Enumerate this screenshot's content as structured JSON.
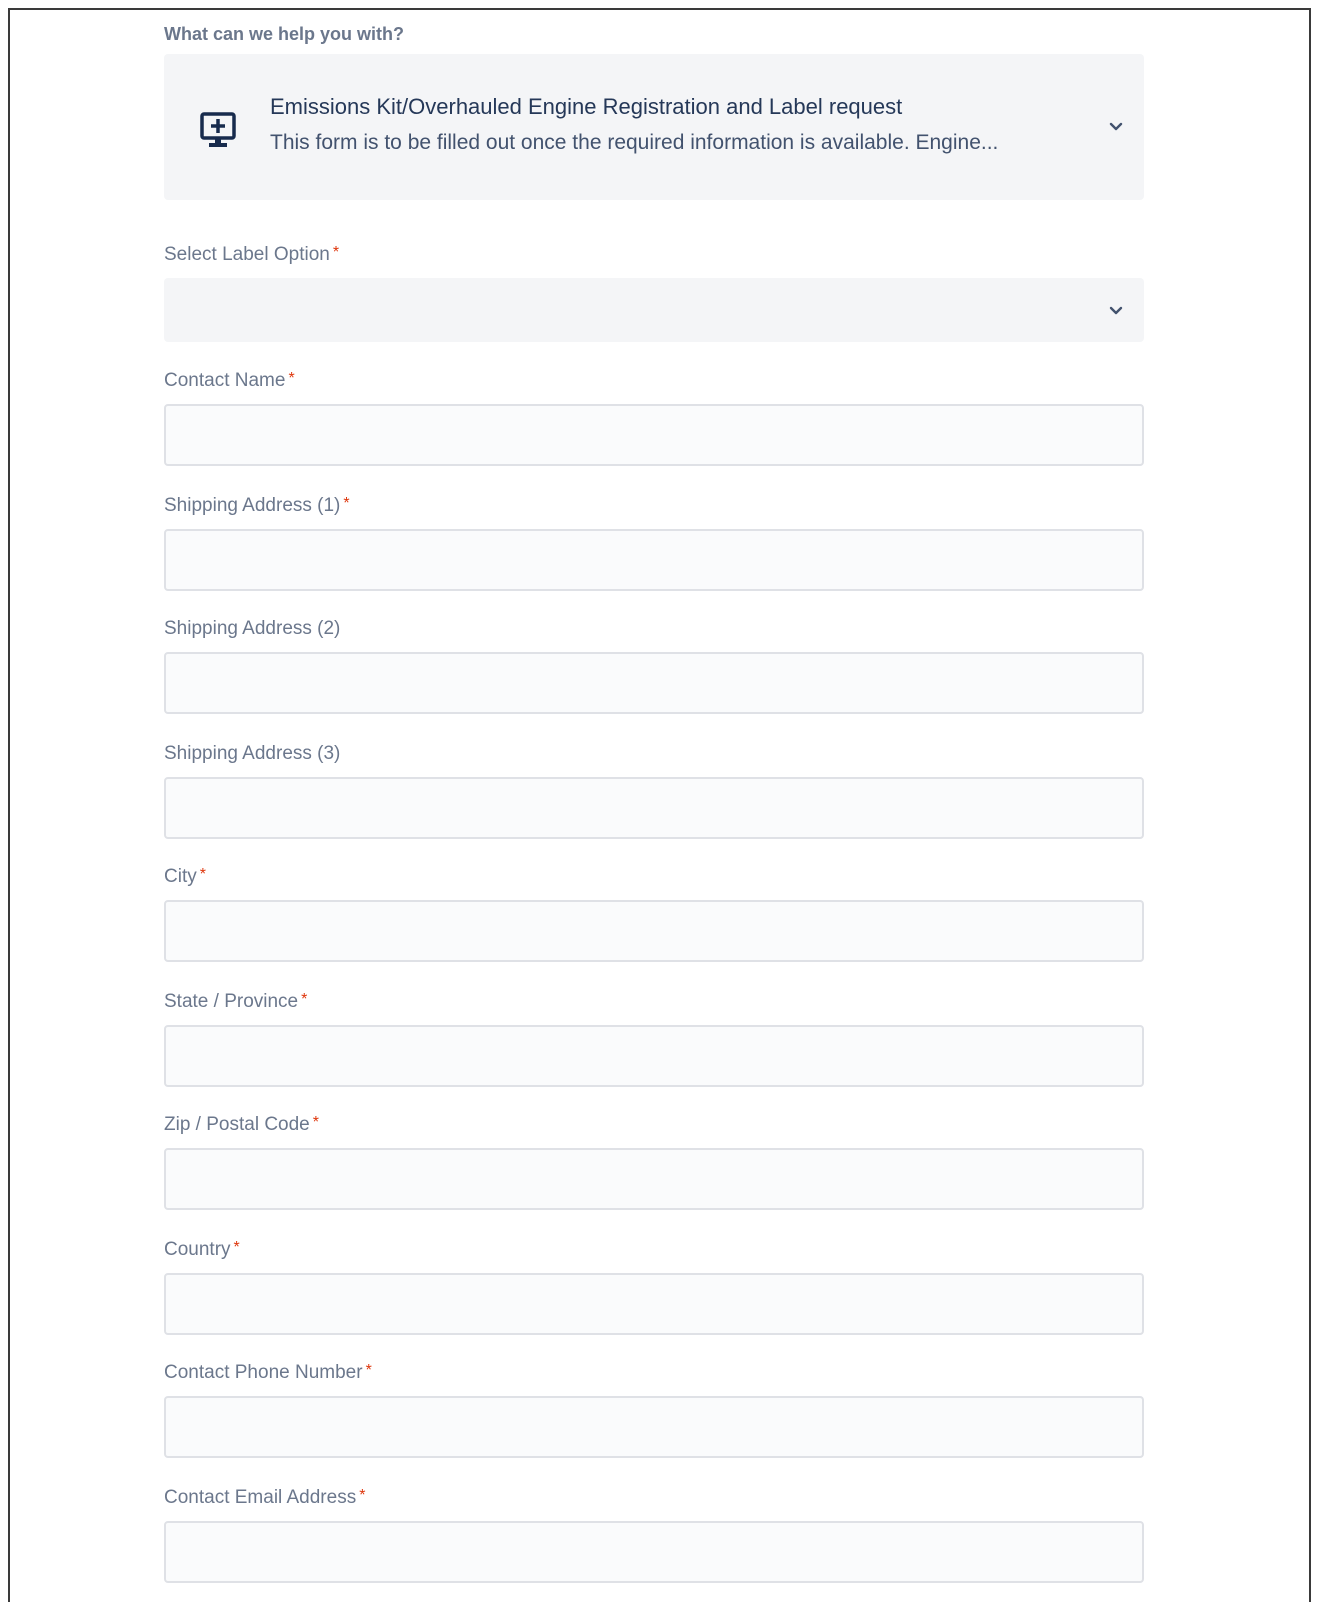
{
  "form": {
    "help_label": "What can we help you with?",
    "request_type": {
      "icon": "monitor-plus-icon",
      "title": "Emissions Kit/Overhauled Engine Registration and Label request",
      "description": "This form is to be filled out once the required information is available. Engine..."
    },
    "label_option": {
      "label": "Select Label Option",
      "required": "*",
      "selected": ""
    },
    "fields": [
      {
        "label": "Contact Name",
        "required": "*",
        "value": ""
      },
      {
        "label": "Shipping Address (1)",
        "required": "*",
        "value": ""
      },
      {
        "label": "Shipping Address (2)",
        "required": "",
        "value": ""
      },
      {
        "label": "Shipping Address (3)",
        "required": "",
        "value": ""
      },
      {
        "label": "City",
        "required": "*",
        "value": ""
      },
      {
        "label": "State / Province",
        "required": "*",
        "value": ""
      },
      {
        "label": "Zip / Postal Code",
        "required": "*",
        "value": ""
      },
      {
        "label": "Country",
        "required": "*",
        "value": ""
      },
      {
        "label": "Contact Phone Number",
        "required": "*",
        "value": ""
      },
      {
        "label": "Contact Email Address",
        "required": "*",
        "value": ""
      }
    ]
  },
  "colors": {
    "label": "#6b778c",
    "title": "#253858",
    "required": "#de350b",
    "panel": "#f4f5f7",
    "input_bg": "#fafbfc",
    "input_border": "#dfe1e6"
  }
}
